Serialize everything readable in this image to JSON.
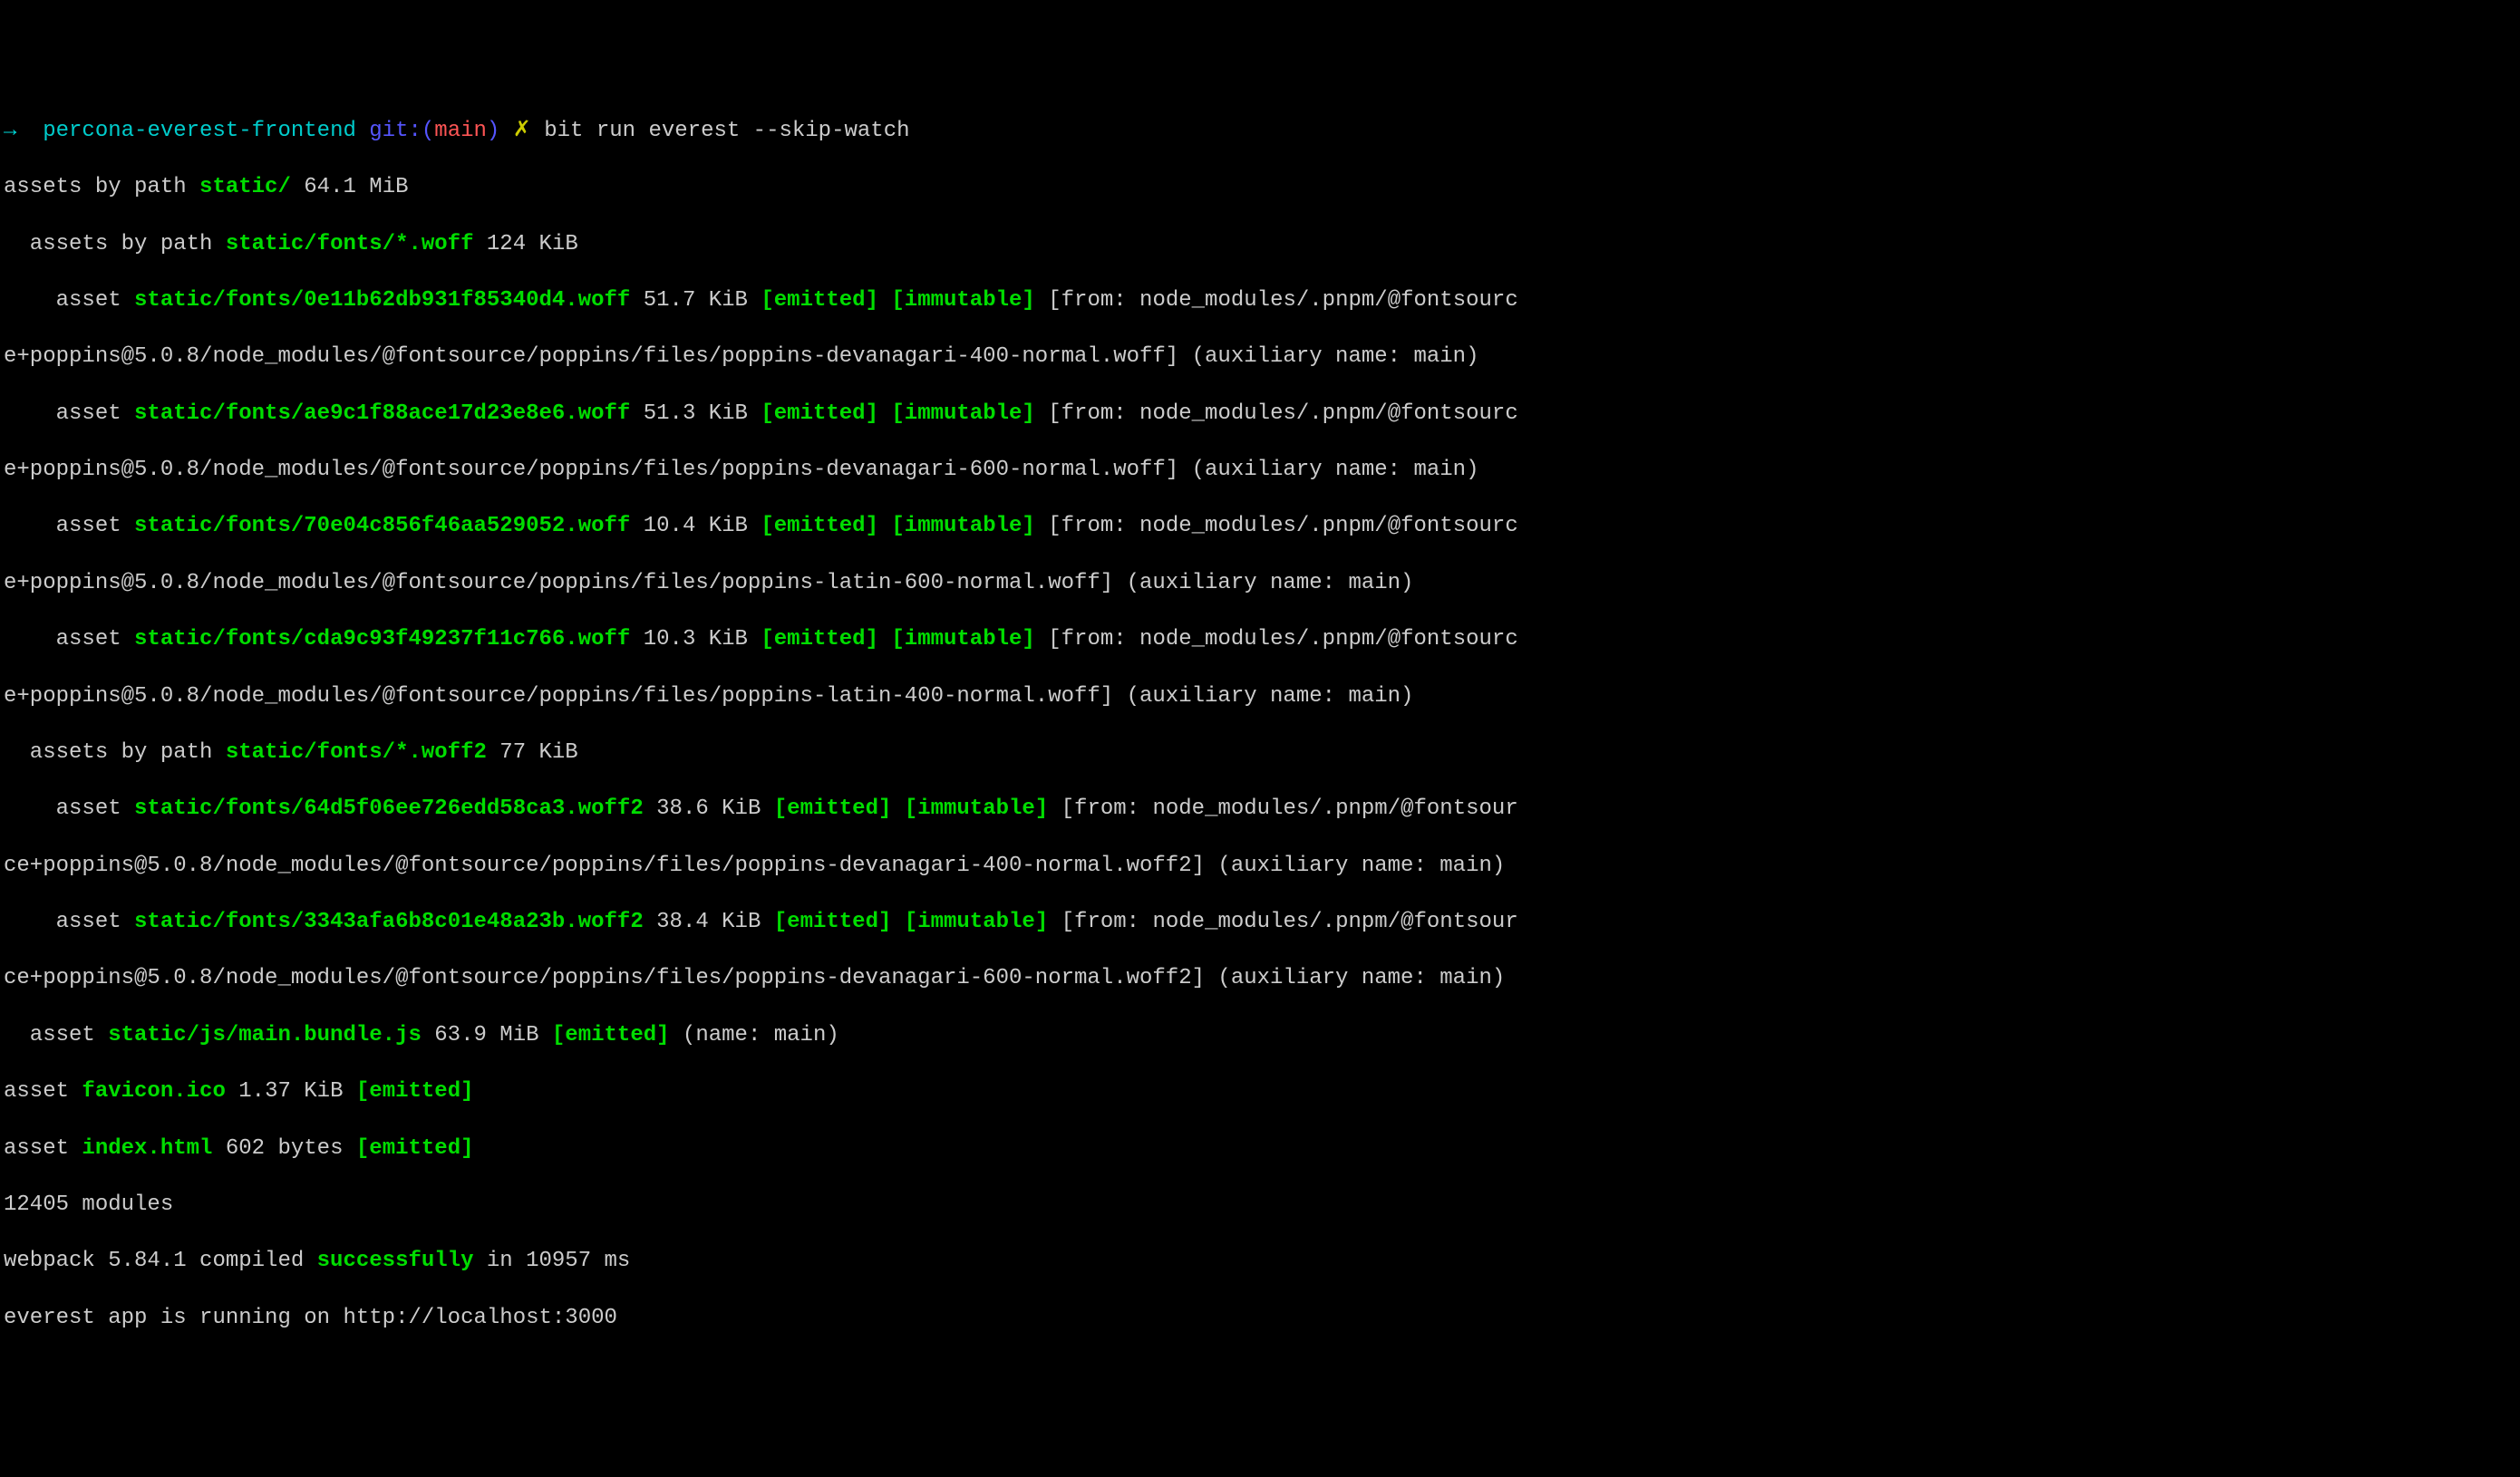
{
  "prompt": {
    "arrow": "→",
    "repo": "percona-everest-frontend",
    "git_prefix": "git:(",
    "branch": "main",
    "git_suffix": ")",
    "dirty": "✗",
    "command": "bit run everest --skip-watch"
  },
  "output": {
    "line1_prefix": "assets by path ",
    "line1_path": "static/",
    "line1_size": " 64.1 MiB",
    "line2_prefix": "  assets by path ",
    "line2_path": "static/fonts/*.woff",
    "line2_size": " 124 KiB",
    "asset_label": "    asset ",
    "emitted": "[emitted]",
    "immutable": "[immutable]",
    "woff1_path": "static/fonts/0e11b62db931f85340d4.woff",
    "woff1_size": " 51.7 KiB ",
    "woff1_from": " [from: node_modules/.pnpm/@fontsourc",
    "woff1_cont": "e+poppins@5.0.8/node_modules/@fontsource/poppins/files/poppins-devanagari-400-normal.woff] (auxiliary name: main)",
    "woff2_path": "static/fonts/ae9c1f88ace17d23e8e6.woff",
    "woff2_size": " 51.3 KiB ",
    "woff2_from": " [from: node_modules/.pnpm/@fontsourc",
    "woff2_cont": "e+poppins@5.0.8/node_modules/@fontsource/poppins/files/poppins-devanagari-600-normal.woff] (auxiliary name: main)",
    "woff3_path": "static/fonts/70e04c856f46aa529052.woff",
    "woff3_size": " 10.4 KiB ",
    "woff3_from": " [from: node_modules/.pnpm/@fontsourc",
    "woff3_cont": "e+poppins@5.0.8/node_modules/@fontsource/poppins/files/poppins-latin-600-normal.woff] (auxiliary name: main)",
    "woff4_path": "static/fonts/cda9c93f49237f11c766.woff",
    "woff4_size": " 10.3 KiB ",
    "woff4_from": " [from: node_modules/.pnpm/@fontsourc",
    "woff4_cont": "e+poppins@5.0.8/node_modules/@fontsource/poppins/files/poppins-latin-400-normal.woff] (auxiliary name: main)",
    "line_woff2_prefix": "  assets by path ",
    "line_woff2_path": "static/fonts/*.woff2",
    "line_woff2_size": " 77 KiB",
    "w2_1_path": "static/fonts/64d5f06ee726edd58ca3.woff2",
    "w2_1_size": " 38.6 KiB ",
    "w2_1_from": " [from: node_modules/.pnpm/@fontsour",
    "w2_1_cont": "ce+poppins@5.0.8/node_modules/@fontsource/poppins/files/poppins-devanagari-400-normal.woff2] (auxiliary name: main)",
    "w2_2_path": "static/fonts/3343afa6b8c01e48a23b.woff2",
    "w2_2_size": " 38.4 KiB ",
    "w2_2_from": " [from: node_modules/.pnpm/@fontsour",
    "w2_2_cont": "ce+poppins@5.0.8/node_modules/@fontsource/poppins/files/poppins-devanagari-600-normal.woff2] (auxiliary name: main)",
    "bundle_prefix": "  asset ",
    "bundle_path": "static/js/main.bundle.js",
    "bundle_size": " 63.9 MiB ",
    "bundle_name": " (name: main)",
    "favicon_prefix": "asset ",
    "favicon_path": "favicon.ico",
    "favicon_size": " 1.37 KiB ",
    "index_prefix": "asset ",
    "index_path": "index.html",
    "index_size": " 602 bytes ",
    "modules": "12405 modules",
    "webpack_prefix": "webpack 5.84.1 compiled ",
    "successfully": "successfully",
    "webpack_suffix": " in 10957 ms",
    "running": "everest app is running on http://localhost:3000",
    "space": " "
  }
}
